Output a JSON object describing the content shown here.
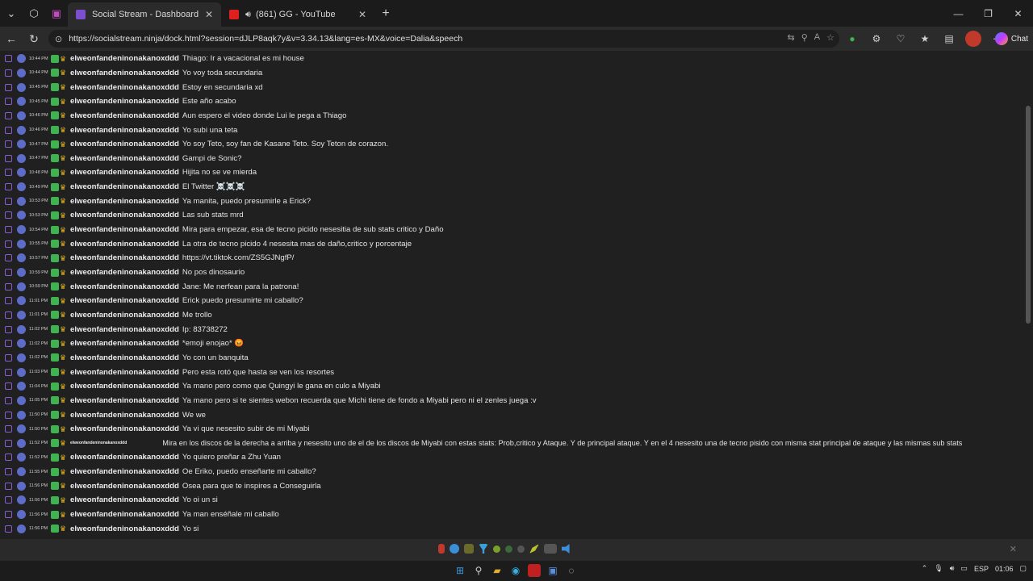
{
  "tabs": [
    {
      "title": "Social Stream - Dashboard",
      "active": true
    },
    {
      "title": "(861) GG - YouTube",
      "active": false
    }
  ],
  "address": {
    "url": "https://socialstream.ninja/dock.html?session=dJLP8aqk7y&v=3.34.13&lang=es-MX&voice=Dalia&speech"
  },
  "browser": {
    "chat_label": "Chat"
  },
  "messages": [
    {
      "time": "10:44 PM",
      "user": "elweonfandeninonakanoxddd",
      "text": "Thiago: Ir a vacacional es mi house"
    },
    {
      "time": "10:44 PM",
      "user": "elweonfandeninonakanoxddd",
      "text": "Yo voy toda secundaria"
    },
    {
      "time": "10:45 PM",
      "user": "elweonfandeninonakanoxddd",
      "text": "Estoy en secundaria xd"
    },
    {
      "time": "10:45 PM",
      "user": "elweonfandeninonakanoxddd",
      "text": "Este año acabo"
    },
    {
      "time": "10:46 PM",
      "user": "elweonfandeninonakanoxddd",
      "text": "Aun espero el video donde Lui le pega a Thiago"
    },
    {
      "time": "10:46 PM",
      "user": "elweonfandeninonakanoxddd",
      "text": "Yo subi una teta"
    },
    {
      "time": "10:47 PM",
      "user": "elweonfandeninonakanoxddd",
      "text": "Yo soy Teto, soy fan de Kasane Teto. Soy Teton de corazon."
    },
    {
      "time": "10:47 PM",
      "user": "elweonfandeninonakanoxddd",
      "text": "Gampi de Sonic?"
    },
    {
      "time": "10:48 PM",
      "user": "elweonfandeninonakanoxddd",
      "text": "Hijita no se ve mierda"
    },
    {
      "time": "10:49 PM",
      "user": "elweonfandeninonakanoxddd",
      "text": "El Twitter ☠️☠️☠️"
    },
    {
      "time": "10:53 PM",
      "user": "elweonfandeninonakanoxddd",
      "text": "Ya manita, puedo presumirle a Erick?"
    },
    {
      "time": "10:53 PM",
      "user": "elweonfandeninonakanoxddd",
      "text": "Las sub stats mrd"
    },
    {
      "time": "10:54 PM",
      "user": "elweonfandeninonakanoxddd",
      "text": "Mira para empezar, esa de tecno picido nesesitia de sub stats critico y Daño"
    },
    {
      "time": "10:55 PM",
      "user": "elweonfandeninonakanoxddd",
      "text": "La otra de tecno picido 4 nesesita mas de daño,critico y porcentaje"
    },
    {
      "time": "10:57 PM",
      "user": "elweonfandeninonakanoxddd",
      "text": "https://vt.tiktok.com/ZS5GJNgfP/"
    },
    {
      "time": "10:59 PM",
      "user": "elweonfandeninonakanoxddd",
      "text": "No pos dinosaurio"
    },
    {
      "time": "10:59 PM",
      "user": "elweonfandeninonakanoxddd",
      "text": "Jane: Me nerfean para la patrona!"
    },
    {
      "time": "11:01 PM",
      "user": "elweonfandeninonakanoxddd",
      "text": "Erick puedo presumirte mi caballo?"
    },
    {
      "time": "11:01 PM",
      "user": "elweonfandeninonakanoxddd",
      "text": "Me trollo"
    },
    {
      "time": "11:02 PM",
      "user": "elweonfandeninonakanoxddd",
      "text": "Ip: 83738272"
    },
    {
      "time": "11:02 PM",
      "user": "elweonfandeninonakanoxddd",
      "text": "*emoji enojao* 😡"
    },
    {
      "time": "11:02 PM",
      "user": "elweonfandeninonakanoxddd",
      "text": "Yo con un banquita"
    },
    {
      "time": "11:03 PM",
      "user": "elweonfandeninonakanoxddd",
      "text": "Pero esta rotó que hasta se ven los resortes"
    },
    {
      "time": "11:04 PM",
      "user": "elweonfandeninonakanoxddd",
      "text": "Ya mano pero como que Quingyi le gana en culo a Miyabi"
    },
    {
      "time": "11:05 PM",
      "user": "elweonfandeninonakanoxddd",
      "text": "Ya mano pero si te sientes webon recuerda que Michi tiene de fondo a Miyabi pero ni el zenles juega :v"
    },
    {
      "time": "11:50 PM",
      "user": "elweonfandeninonakanoxddd",
      "text": "We we"
    },
    {
      "time": "11:50 PM",
      "user": "elweonfandeninonakanoxddd",
      "text": "Ya vi que nesesito subir de mi Miyabi"
    },
    {
      "time": "11:52 PM",
      "user": "elweonfandeninonakanoxddd",
      "text": "Mira en los discos de la derecha a arriba y nesesito uno de el de los discos de Miyabi con estas stats: Prob,critico y Ataque. Y de principal ataque. Y en el 4 nesesito una de tecno pisido con misma stat principal de ataque y las mismas sub stats",
      "small_user": true
    },
    {
      "time": "11:52 PM",
      "user": "elweonfandeninonakanoxddd",
      "text": "Yo quiero preñar a Zhu Yuan"
    },
    {
      "time": "11:55 PM",
      "user": "elweonfandeninonakanoxddd",
      "text": "Oe Eriko, puedo enseñarte mi caballo?"
    },
    {
      "time": "11:56 PM",
      "user": "elweonfandeninonakanoxddd",
      "text": "Osea para que te inspires a Conseguirla"
    },
    {
      "time": "11:56 PM",
      "user": "elweonfandeninonakanoxddd",
      "text": "Yo oi un si"
    },
    {
      "time": "11:56 PM",
      "user": "elweonfandeninonakanoxddd",
      "text": "Ya man enséñale mi caballo"
    },
    {
      "time": "11:56 PM",
      "user": "elweonfandeninonakanoxddd",
      "text": "Yo si"
    }
  ],
  "taskbar": {
    "language": "ESP",
    "clock": "01:06"
  }
}
